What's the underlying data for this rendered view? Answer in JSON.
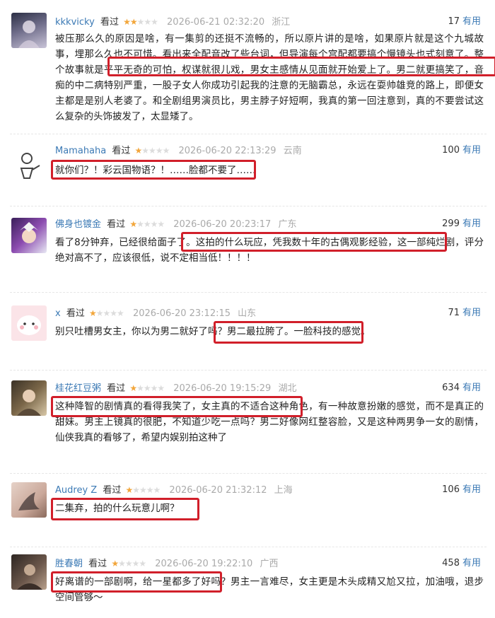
{
  "comments": [
    {
      "user": "kkkvicky",
      "watched": "看过",
      "stars": 2,
      "time": "2026-06-21 02:32:20",
      "location": "浙江",
      "votes": "17",
      "useful": "有用",
      "avatar_colors": [
        "#4a4d6b",
        "#c9c4d8"
      ],
      "content": "被压那么久的原因是啥，有一集剪的还挺不流畅的，所以原片讲的是啥，如果原片就是这个九城故事，埋那么久也不可惜。看出来全配音改了些台词，但导演每个宫配都要搞个慢镜头也式刻意了。整个故事就是平平无奇的可怕，权谋就很儿戏，男女主感情从见面就开始爱上了。男二就更搞笑了，音痴的中二病特别严重，一股子女人你成功引起我的注意的无脑霸总，永远在耍帅雄竞的路上，即便女主都是是别人老婆了。和全剧组男演员比，男主脖子好短啊，我真的第一回注意到，真的不要尝试这么复杂的头饰披发了，太显矮了。"
    },
    {
      "user": "Mamahaha",
      "watched": "看过",
      "stars": 1,
      "time": "2026-06-20 22:13:29",
      "location": "云南",
      "votes": "100",
      "useful": "有用",
      "avatar_colors": [
        "#ffffff",
        "#555555"
      ],
      "content": "就你们？！彩云国物语？！……脸都不要了……"
    },
    {
      "user": "佛身也镀金",
      "watched": "看过",
      "stars": 1,
      "time": "2026-06-20 20:23:17",
      "location": "广东",
      "votes": "299",
      "useful": "有用",
      "avatar_colors": [
        "#5a2d7a",
        "#e0e0f0"
      ],
      "content": "看了8分钟弃，已经很给面子了。这拍的什么玩应，凭我数十年的古偶观影经验，这一部纯烂剧，评分绝对高不了，应该很低，说不定相当低！！！！"
    },
    {
      "user": "x",
      "watched": "看过",
      "stars": 1,
      "time": "2026-06-20 23:12:15",
      "location": "山东",
      "votes": "71",
      "useful": "有用",
      "avatar_colors": [
        "#f6d3d8",
        "#ffffff"
      ],
      "content": "别只吐槽男女主，你以为男二就好了吗？男二最拉胯了。一脸科技的感觉。"
    },
    {
      "user": "桂花红豆粥",
      "watched": "看过",
      "stars": 1,
      "time": "2026-06-20 19:15:29",
      "location": "湖北",
      "votes": "634",
      "useful": "有用",
      "avatar_colors": [
        "#6b5a3c",
        "#d8c8a8"
      ],
      "content": "这种降智的剧情真的看得我笑了，女主真的不适合这种角色，有一种故意扮嫩的感觉，而不是真正的甜妹。男主上镜真的很肥，不知道少吃一点吗？男二好像网红整容脸，又是这种两男争一女的剧情，仙侠我真的看够了，希望内娱别拍这种了"
    },
    {
      "user": "Audrey Z",
      "watched": "看过",
      "stars": 1,
      "time": "2026-06-20 21:32:12",
      "location": "上海",
      "votes": "106",
      "useful": "有用",
      "avatar_colors": [
        "#caa89a",
        "#3a3030"
      ],
      "content": "二集弃，拍的什么玩意儿啊？"
    },
    {
      "user": "胜春朝",
      "watched": "看过",
      "stars": 1,
      "time": "2026-06-20 19:22:10",
      "location": "广西",
      "votes": "458",
      "useful": "有用",
      "avatar_colors": [
        "#4b3c34",
        "#b8a08c"
      ],
      "content": "好离谱的一部剧啊，给一星都多了好吗？男主一言难尽，女主更是木头成精又尬又拉，加油哦，退步空间管够～"
    }
  ]
}
